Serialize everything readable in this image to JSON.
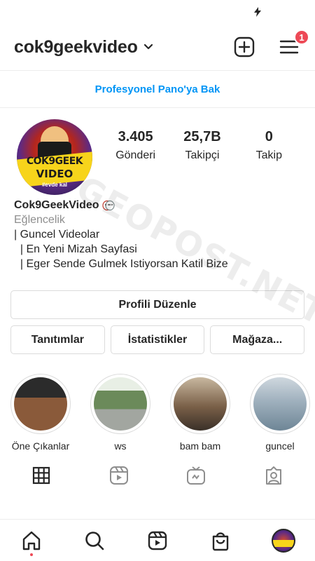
{
  "status_bar": {
    "icon": "flash-icon"
  },
  "header": {
    "username": "cok9geekvideo",
    "notification_count": "1"
  },
  "pro_dashboard": {
    "label": "Profesyonel Pano'ya Bak"
  },
  "avatar": {
    "line1": "COK9GEEK",
    "line2": "VIDEO",
    "line3": "#evde kal"
  },
  "stats": [
    {
      "value": "3.405",
      "label": "Gönderi"
    },
    {
      "value": "25,7B",
      "label": "Takipçi"
    },
    {
      "value": "0",
      "label": "Takip"
    }
  ],
  "bio": {
    "name": "Cok9GeekVideo",
    "category": "Eğlencelik",
    "lines": [
      "| Guncel Videolar",
      "  | En Yeni Mizah Sayfasi",
      "  | Eger Sende Gulmek Istiyorsan Katil Bize"
    ]
  },
  "buttons": {
    "edit_profile": "Profili Düzenle",
    "promotions": "Tanıtımlar",
    "insights": "İstatistikler",
    "shop": "Mağaza..."
  },
  "highlights": [
    {
      "label": "Öne Çıkanlar"
    },
    {
      "label": "ws"
    },
    {
      "label": "bam bam"
    },
    {
      "label": "guncel"
    }
  ],
  "watermark": "GEOPOST.NET",
  "colors": {
    "accent": "#0095f6",
    "badge": "#ed4956",
    "border": "#dbdbdb",
    "text": "#262626",
    "muted": "#8e8e8e"
  }
}
